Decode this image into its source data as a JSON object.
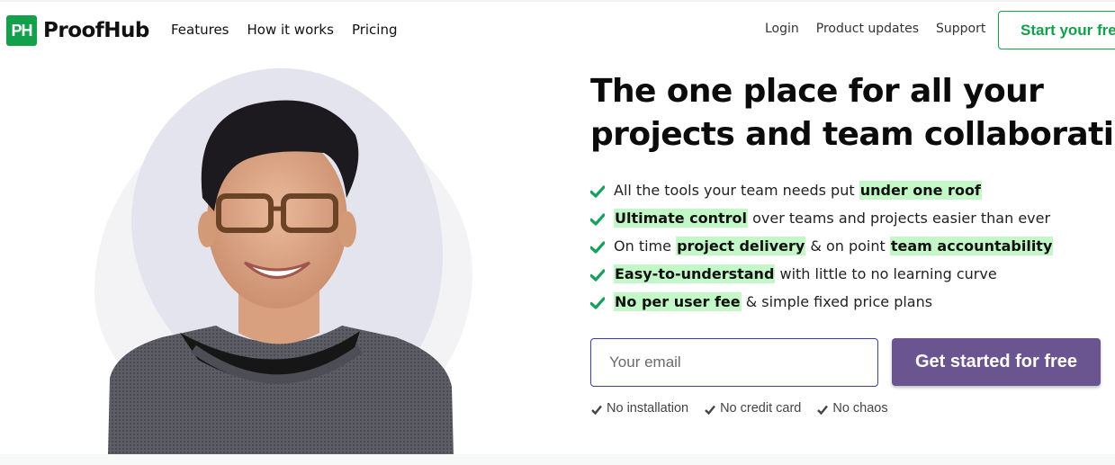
{
  "header": {
    "logo_mark": "PH",
    "logo_text": "ProofHub",
    "nav_left": [
      {
        "label": "Features"
      },
      {
        "label": "How it works"
      },
      {
        "label": "Pricing"
      }
    ],
    "nav_right": [
      {
        "label": "Login"
      },
      {
        "label": "Product updates"
      },
      {
        "label": "Support"
      }
    ],
    "trial_button": "Start your free trial"
  },
  "hero": {
    "headline_line1": "The one place for all your",
    "headline_line2": "projects and team collaboration",
    "features": [
      {
        "parts": [
          {
            "text": "All the tools your team needs put ",
            "highlight": false
          },
          {
            "text": "under one roof",
            "highlight": true
          }
        ]
      },
      {
        "parts": [
          {
            "text": "Ultimate control",
            "highlight": true
          },
          {
            "text": " over teams and projects easier than ever",
            "highlight": false
          }
        ]
      },
      {
        "parts": [
          {
            "text": "On time ",
            "highlight": false
          },
          {
            "text": "project delivery",
            "highlight": true
          },
          {
            "text": " & on point ",
            "highlight": false
          },
          {
            "text": "team accountability",
            "highlight": true
          }
        ]
      },
      {
        "parts": [
          {
            "text": "Easy-to-understand",
            "highlight": true
          },
          {
            "text": " with little to no learning curve",
            "highlight": false
          }
        ]
      },
      {
        "parts": [
          {
            "text": "No per user fee",
            "highlight": true
          },
          {
            "text": " & simple fixed price plans",
            "highlight": false
          }
        ]
      }
    ],
    "email_placeholder": "Your email",
    "email_value": "",
    "cta_button": "Get started for free",
    "perks": [
      "No installation",
      "No credit card",
      "No chaos"
    ],
    "image_alt": "Smiling woman with glasses"
  },
  "colors": {
    "brand_green": "#12a14a",
    "highlight": "#c3f7c8",
    "cta_purple": "#6b5591",
    "check_green": "#17a05d"
  }
}
